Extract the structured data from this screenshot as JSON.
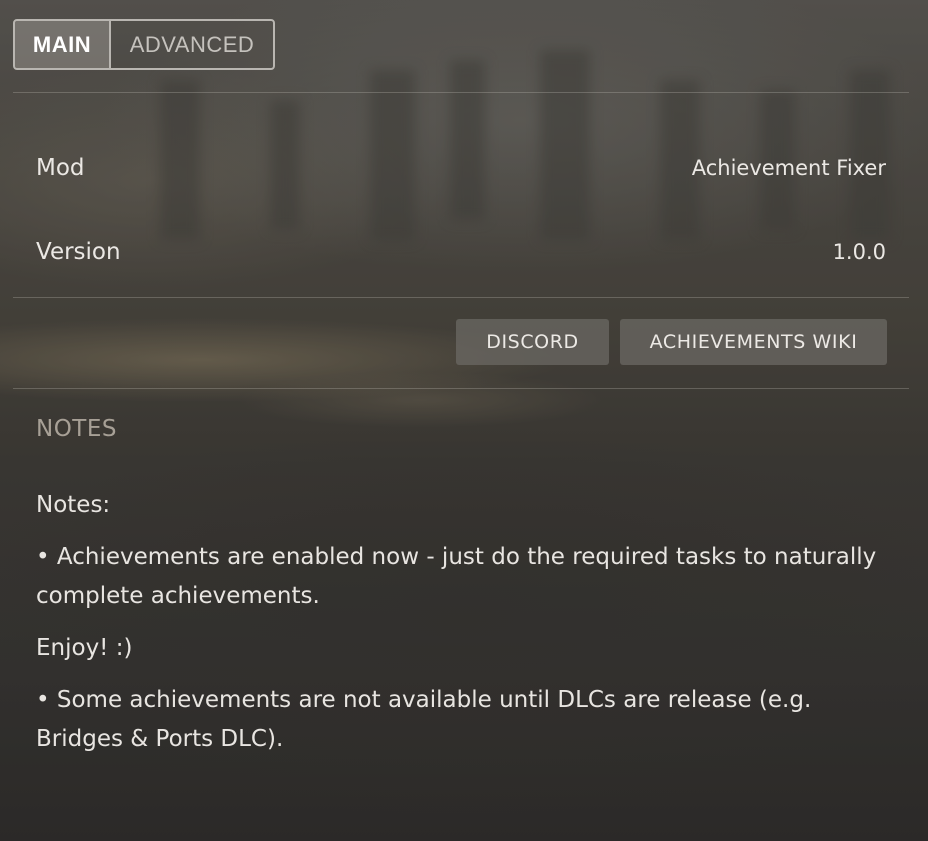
{
  "tabs": {
    "main": "MAIN",
    "advanced": "ADVANCED"
  },
  "info": {
    "mod_label": "Mod",
    "mod_value": "Achievement Fixer",
    "version_label": "Version",
    "version_value": "1.0.0"
  },
  "buttons": {
    "discord": "DISCORD",
    "wiki": "ACHIEVEMENTS WIKI"
  },
  "notes": {
    "heading": "NOTES",
    "lines": [
      "Notes:",
      "• Achievements are enabled now - just do the required tasks to naturally complete achievements.",
      "Enjoy! :)",
      "• Some achievements are not available until DLCs are release (e.g. Bridges & Ports DLC)."
    ]
  }
}
